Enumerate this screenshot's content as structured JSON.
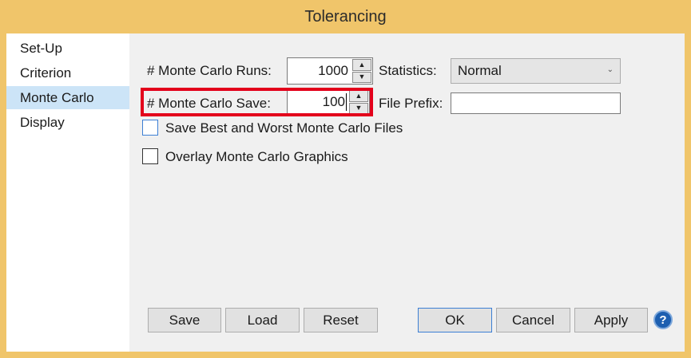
{
  "window": {
    "title": "Tolerancing"
  },
  "sidebar": {
    "items": [
      {
        "label": "Set-Up"
      },
      {
        "label": "Criterion"
      },
      {
        "label": "Monte Carlo",
        "selected": true
      },
      {
        "label": "Display"
      }
    ]
  },
  "monte_carlo": {
    "runs_label": "# Monte Carlo Runs:",
    "runs_value": "1000",
    "statistics_label": "Statistics:",
    "statistics_value": "Normal",
    "save_label": "# Monte Carlo Save:",
    "save_value": "100",
    "file_prefix_label": "File Prefix:",
    "file_prefix_value": "",
    "save_best_worst_label": "Save Best and Worst Monte Carlo Files",
    "save_best_worst_checked": false,
    "overlay_label": "Overlay Monte Carlo Graphics",
    "overlay_checked": false
  },
  "buttons": {
    "save": "Save",
    "load": "Load",
    "reset": "Reset",
    "ok": "OK",
    "cancel": "Cancel",
    "apply": "Apply"
  },
  "icons": {
    "spin_up": "▲",
    "spin_down": "▼",
    "dropdown": "chevron-down-icon",
    "help": "?"
  },
  "colors": {
    "title_bar": "#f0c56a",
    "selected_item": "#cce4f7",
    "highlight_border": "#e3001b",
    "focus_border": "#3c7fd4"
  }
}
